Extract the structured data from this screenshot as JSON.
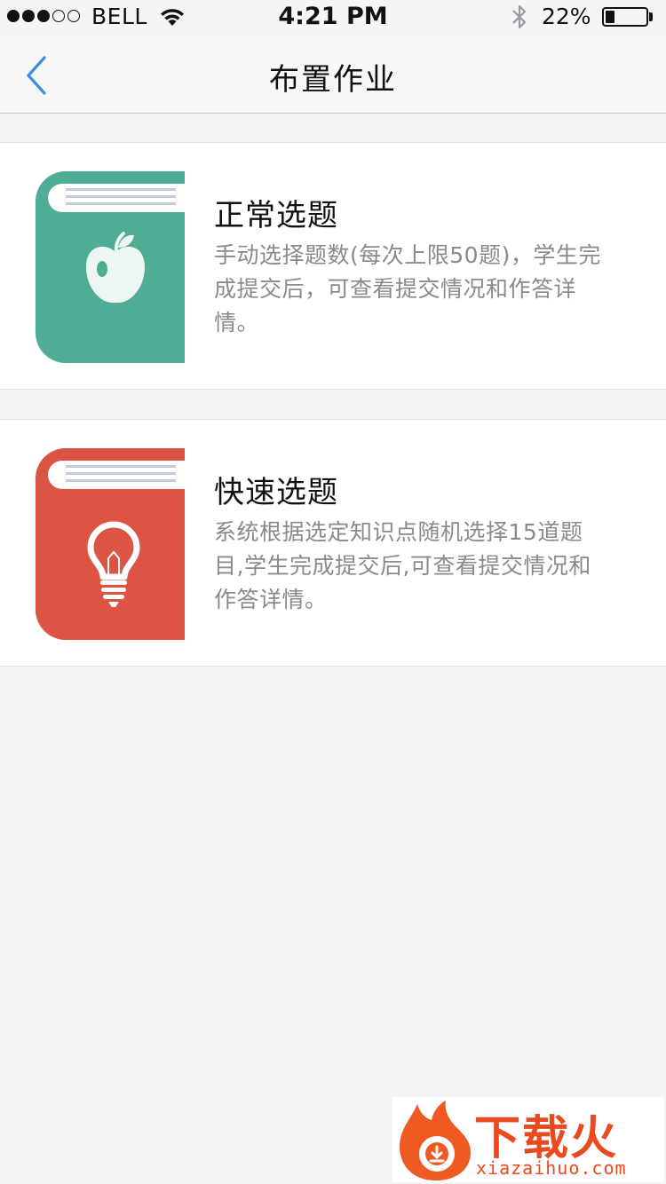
{
  "status_bar": {
    "carrier": "BELL",
    "time": "4:21 PM",
    "battery_percent": "22%",
    "battery_level": 0.22,
    "signal_bars": 3,
    "signal_total": 5,
    "icons": [
      "wifi-icon",
      "bluetooth-icon",
      "battery-icon"
    ]
  },
  "nav": {
    "title": "布置作业",
    "back_icon": "chevron-left-icon",
    "accent_color": "#3b8fe0"
  },
  "options": [
    {
      "title": "正常选题",
      "description": "手动选择题数(每次上限50题)，学生完成提交后，可查看提交情况和作答详情。",
      "icon": "apple-icon",
      "color": "#4fad96"
    },
    {
      "title": "快速选题",
      "description": "系统根据选定知识点随机选择15道题目,学生完成提交后,可查看提交情况和作答详情。",
      "icon": "lightbulb-icon",
      "color": "#dc5444"
    }
  ],
  "watermark": {
    "name": "下载火",
    "url": "xiazaihuo.com",
    "color": "#ea4a1f"
  }
}
